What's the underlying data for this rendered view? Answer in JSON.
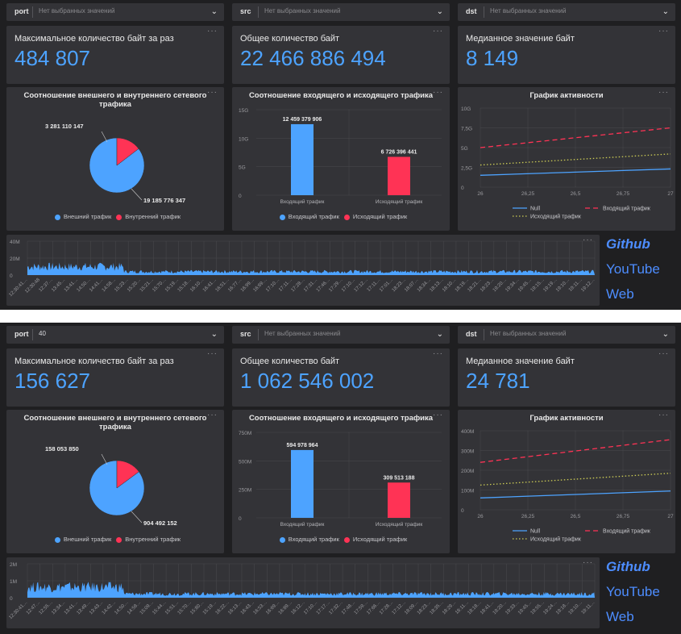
{
  "colors": {
    "blue": "#4da3ff",
    "red": "#ff3355",
    "yellow": "#cccc55",
    "link": "#4d8dff"
  },
  "dashboards": [
    {
      "filters": [
        {
          "label": "port",
          "value": "Нет выбранных значений"
        },
        {
          "label": "src",
          "value": "Нет выбранных значений"
        },
        {
          "label": "dst",
          "value": "Нет выбранных значений"
        }
      ],
      "kpis": [
        {
          "title": "Максимальное количество байт за раз",
          "value": "484 807"
        },
        {
          "title": "Общее количество байт",
          "value": "22 466 886 494"
        },
        {
          "title": "Медианное значение байт",
          "value": "8 149"
        }
      ],
      "pie": {
        "title": "Соотношение внешнего и внутреннего сетевого трафика",
        "labels": [
          "19 185 776 347",
          "3 281 110 147"
        ],
        "legend": [
          "Внешний трафик",
          "Внутренний трафик"
        ]
      },
      "bar": {
        "title": "Соотношение входящего и исходящего трафика",
        "value_labels": [
          "12 459 379 906",
          "6 726 396 441"
        ],
        "legend": [
          "Входящий трафик",
          "Исходящий трафик"
        ]
      },
      "line": {
        "title": "График активности",
        "legend": [
          "Null",
          "Входящий трафик",
          "Исходящий трафик"
        ]
      },
      "timeline": {
        "time_labels": [
          "12:30:41…",
          "12:30:48",
          "12:37…",
          "13:45…",
          "13:41…",
          "14:50…",
          "14:41…",
          "14:58…",
          "15:23…",
          "15:20…",
          "15:21…",
          "15:70…",
          "15:19…",
          "15:18…",
          "16:10…",
          "16:41…",
          "16:51…",
          "16:77…",
          "16:99…",
          "16:69…",
          "17:10…",
          "17:11…",
          "17:28…",
          "17:31…",
          "17:46…",
          "17:29…",
          "17:10…",
          "17:12…",
          "17:11…",
          "17:01…",
          "18:23…",
          "18:07…",
          "18:34…",
          "18:13…",
          "18:10…",
          "18:19…",
          "18:21…",
          "18:23…",
          "19:20…",
          "19:34…",
          "19:45…",
          "19:15…",
          "19:19…",
          "19:10…",
          "19:11…",
          "19:12…"
        ]
      },
      "links": [
        "Github",
        "YouTube",
        "Web"
      ]
    },
    {
      "filters": [
        {
          "label": "port",
          "value": "40"
        },
        {
          "label": "src",
          "value": "Нет выбранных значений"
        },
        {
          "label": "dst",
          "value": "Нет выбранных значений"
        }
      ],
      "kpis": [
        {
          "title": "Максимальное количество байт за раз",
          "value": "156 627"
        },
        {
          "title": "Общее количество байт",
          "value": "1 062 546 002"
        },
        {
          "title": "Медианное значение байт",
          "value": "24 781"
        }
      ],
      "pie": {
        "title": "Соотношение внешнего и внутреннего сетевого трафика",
        "labels": [
          "904 492 152",
          "158 053 850"
        ],
        "legend": [
          "Внешний трафик",
          "Внутренний трафик"
        ]
      },
      "bar": {
        "title": "Соотношение входящего и исходящего трафика",
        "value_labels": [
          "594 978 964",
          "309 513 188"
        ],
        "legend": [
          "Входящий трафик",
          "Исходящий трафик"
        ]
      },
      "line": {
        "title": "График активности",
        "legend": [
          "Null",
          "Входящий трафик",
          "Исходящий трафик"
        ]
      },
      "timeline": {
        "time_labels": [
          "12:30:41…",
          "12:47…",
          "12:55…",
          "13:34…",
          "13:41…",
          "13:49…",
          "13:43…",
          "14:42…",
          "14:50…",
          "14:58…",
          "15:09…",
          "15:44…",
          "15:51…",
          "15:70…",
          "15:80…",
          "15:19…",
          "16:22…",
          "16:13…",
          "16:43…",
          "16:53…",
          "16:69…",
          "16:89…",
          "16:12…",
          "17:10…",
          "17:17…",
          "17:32…",
          "17:48…",
          "17:59…",
          "17:66…",
          "17:28…",
          "17:12…",
          "18:09…",
          "18:23…",
          "18:35…",
          "18:29…",
          "18:11…",
          "18:18…",
          "18:41…",
          "19:20…",
          "19:33…",
          "19:45…",
          "19:55…",
          "19:24…",
          "19:18…",
          "19:10…",
          "19:11…"
        ]
      },
      "links": [
        "Github",
        "YouTube",
        "Web"
      ]
    }
  ],
  "chart_data": [
    {
      "type": "pie",
      "title": "Соотношение внешнего и внутреннего сетевого трафика",
      "categories": [
        "Внешний трафик",
        "Внутренний трафик"
      ],
      "values": [
        19185776347,
        3281110147
      ]
    },
    {
      "type": "bar",
      "title": "Соотношение входящего и исходящего трафика",
      "categories": [
        "Входящий трафик",
        "Исходящий трафик"
      ],
      "values": [
        12459379906,
        6726396441
      ],
      "ylim": [
        0,
        15000000000
      ],
      "yticks": [
        "0",
        "5G",
        "10G",
        "15G"
      ],
      "colors": [
        "#4da3ff",
        "#ff3355"
      ]
    },
    {
      "type": "line",
      "title": "График активности",
      "x": [
        26,
        27
      ],
      "xticks": [
        "26",
        "26,25",
        "26,5",
        "26,75",
        "27"
      ],
      "yticks": [
        "0",
        "2,5G",
        "5G",
        "7,5G",
        "10G"
      ],
      "ylim": [
        0,
        10000000000
      ],
      "series": [
        {
          "name": "Null",
          "values": [
            1500000000,
            2300000000
          ]
        },
        {
          "name": "Входящий трафик",
          "values": [
            5000000000,
            7500000000
          ]
        },
        {
          "name": "Исходящий трафик",
          "values": [
            2800000000,
            4200000000
          ]
        }
      ]
    },
    {
      "type": "area",
      "yticks": [
        "0",
        "20M",
        "40M"
      ],
      "ylim": [
        0,
        40000000
      ],
      "note_levels": {
        "early": 11000000,
        "late": 4500000
      }
    },
    {
      "type": "pie",
      "title": "Соотношение внешнего и внутреннего сетевого трафика",
      "categories": [
        "Внешний трафик",
        "Внутренний трафик"
      ],
      "values": [
        904492152,
        158053850
      ]
    },
    {
      "type": "bar",
      "title": "Соотношение входящего и исходящего трафика",
      "categories": [
        "Входящий трафик",
        "Исходящий трафик"
      ],
      "values": [
        594978964,
        309513188
      ],
      "ylim": [
        0,
        750000000
      ],
      "yticks": [
        "0",
        "250M",
        "500M",
        "750M"
      ],
      "colors": [
        "#4da3ff",
        "#ff3355"
      ]
    },
    {
      "type": "line",
      "title": "График активности",
      "x": [
        26,
        27
      ],
      "xticks": [
        "26",
        "26,25",
        "26,5",
        "26,75",
        "27"
      ],
      "yticks": [
        "0",
        "100M",
        "200M",
        "300M",
        "400M"
      ],
      "ylim": [
        0,
        400000000
      ],
      "series": [
        {
          "name": "Null",
          "values": [
            60000000,
            95000000
          ]
        },
        {
          "name": "Входящий трафик",
          "values": [
            240000000,
            355000000
          ]
        },
        {
          "name": "Исходящий трафик",
          "values": [
            125000000,
            185000000
          ]
        }
      ]
    },
    {
      "type": "area",
      "yticks": [
        "0",
        "1M",
        "2M"
      ],
      "ylim": [
        0,
        2000000
      ],
      "note_levels": {
        "early": 700000,
        "late": 250000
      }
    }
  ]
}
